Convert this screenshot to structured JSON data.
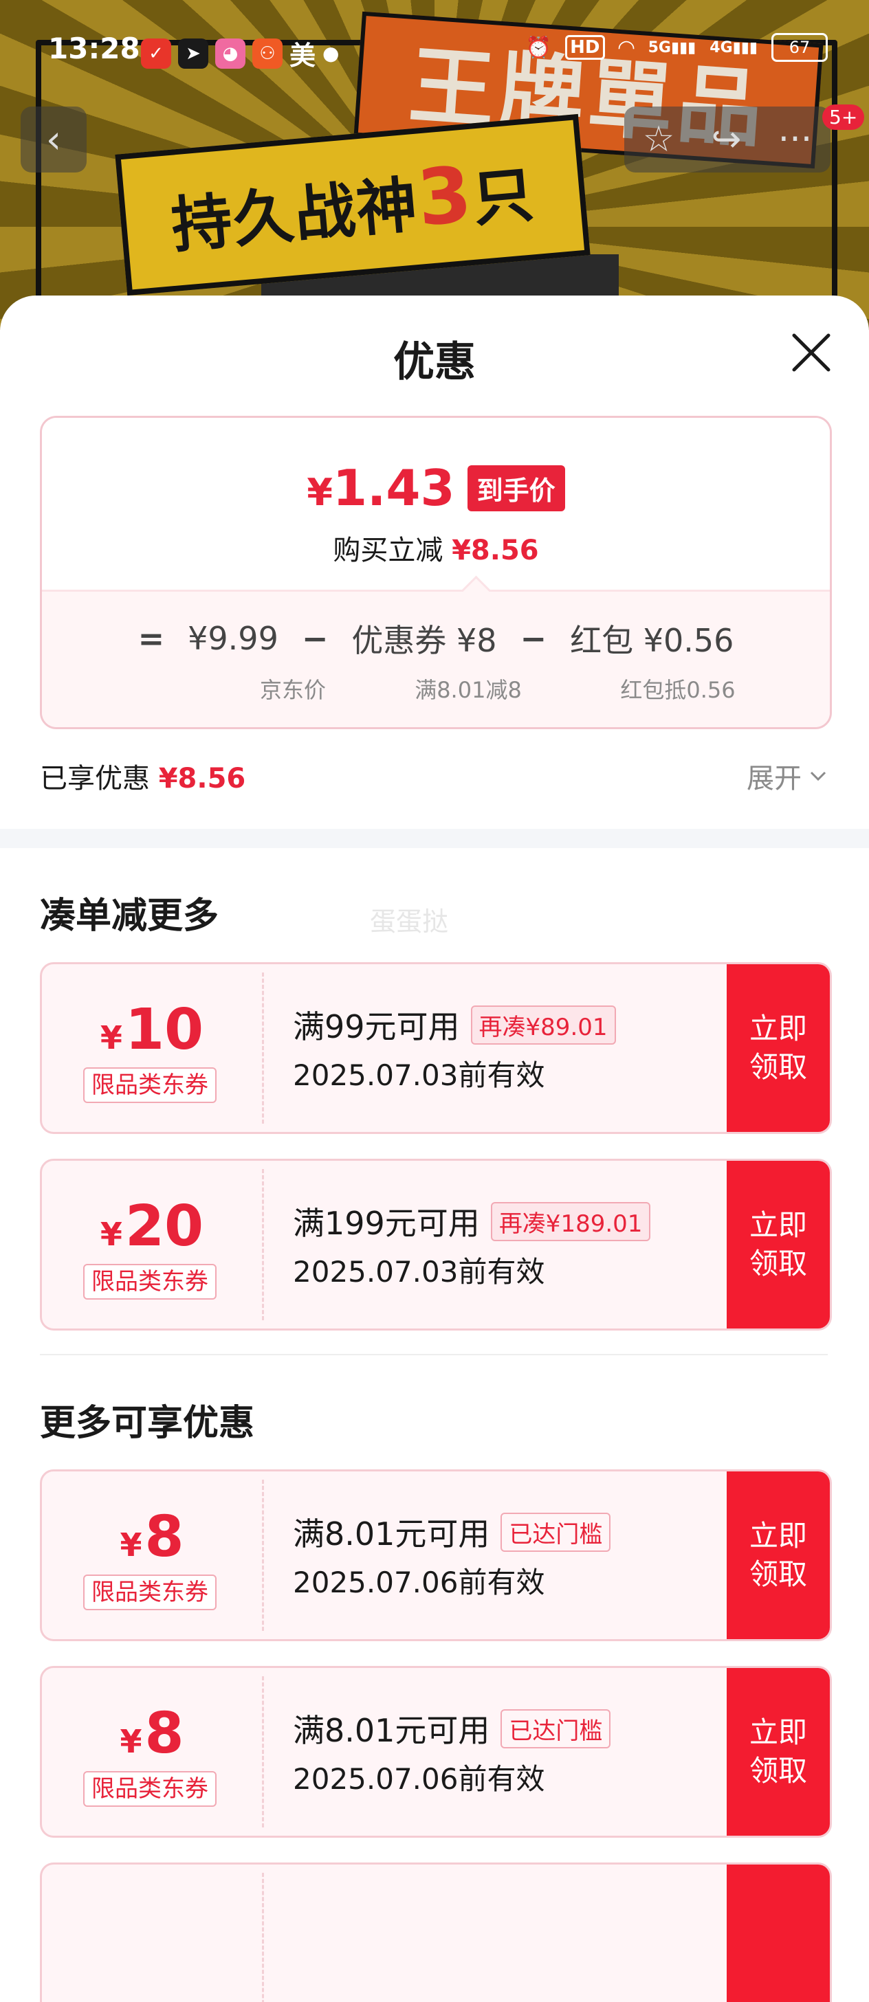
{
  "status_bar": {
    "time": "13:28",
    "carrier_text": "美",
    "network_5g": "5G",
    "network_4g": "4G",
    "hd": "HD",
    "battery": "67"
  },
  "product_banner": {
    "orange_text": "王牌單品",
    "yellow_text_a": "持久战神",
    "yellow_text_num": "3",
    "yellow_text_b": "只"
  },
  "nav": {
    "badge": "5+",
    "more_label": "···"
  },
  "sheet": {
    "title": "优惠",
    "summary": {
      "currency": "¥",
      "final_price": "1.43",
      "final_tag": "到手价",
      "instant_label": "购买立减",
      "instant_value": "¥8.56",
      "eq": "=",
      "minus": "−",
      "jd_price": "¥9.99",
      "jd_price_label": "京东价",
      "coupon_part": "优惠券 ¥8",
      "coupon_part_label": "满8.01减8",
      "redpack_part": "红包 ¥0.56",
      "redpack_part_label": "红包抵0.56"
    },
    "enjoyed_label": "已享优惠",
    "enjoyed_value": "¥8.56",
    "expand_label": "展开",
    "section_more_title": "凑单减更多",
    "watermark": "蛋蛋挞",
    "section_extra_title": "更多可享优惠",
    "coupons": [
      {
        "currency": "¥",
        "amount": "10",
        "kind": "限品类东券",
        "condition": "满99元可用",
        "chip": "再凑¥89.01",
        "valid": "2025.07.03前有效",
        "claim_line1": "立即",
        "claim_line2": "领取"
      },
      {
        "currency": "¥",
        "amount": "20",
        "kind": "限品类东券",
        "condition": "满199元可用",
        "chip": "再凑¥189.01",
        "valid": "2025.07.03前有效",
        "claim_line1": "立即",
        "claim_line2": "领取"
      },
      {
        "currency": "¥",
        "amount": "8",
        "kind": "限品类东券",
        "condition": "满8.01元可用",
        "chip": "已达门槛",
        "valid": "2025.07.06前有效",
        "claim_line1": "立即",
        "claim_line2": "领取"
      },
      {
        "currency": "¥",
        "amount": "8",
        "kind": "限品类东券",
        "condition": "满8.01元可用",
        "chip": "已达门槛",
        "valid": "2025.07.06前有效",
        "claim_line1": "立即",
        "claim_line2": "领取"
      }
    ]
  },
  "colors": {
    "accent_red": "#e8233a",
    "claim_red": "#f31c30"
  }
}
